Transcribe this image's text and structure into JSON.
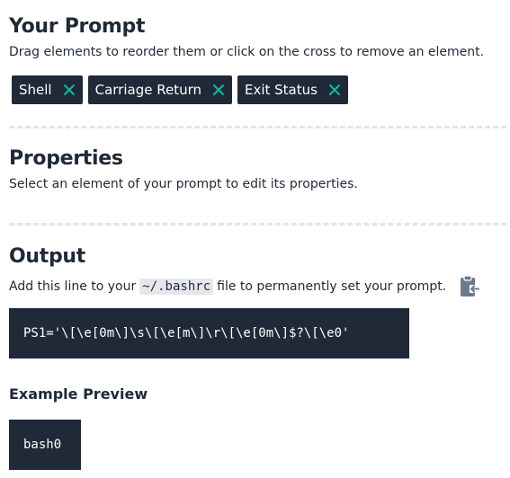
{
  "prompt_section": {
    "title": "Your Prompt",
    "description": "Drag elements to reorder them or click on the cross to remove an element.",
    "elements": [
      {
        "label": "Shell",
        "remove_icon": "close-icon"
      },
      {
        "label": "Carriage Return",
        "remove_icon": "close-icon"
      },
      {
        "label": "Exit Status",
        "remove_icon": "close-icon"
      }
    ]
  },
  "properties_section": {
    "title": "Properties",
    "description": "Select an element of your prompt to edit its properties."
  },
  "output_section": {
    "title": "Output",
    "desc_before": "Add this line to your",
    "file_path": "~/.bashrc",
    "desc_after": "file to permanently set your prompt.",
    "copy_icon": "clipboard-copy-icon",
    "code": "PS1='\\[\\e[0m\\]\\s\\[\\e[m\\]\\r\\[\\e[0m\\]$?\\[\\e0'"
  },
  "example_section": {
    "title": "Example Preview",
    "preview_text": "bash0"
  },
  "colors": {
    "dark": "#1f2937",
    "accent": "#14b8a6",
    "divider": "#e1e4e8",
    "code_bg": "#e5e7eb"
  }
}
